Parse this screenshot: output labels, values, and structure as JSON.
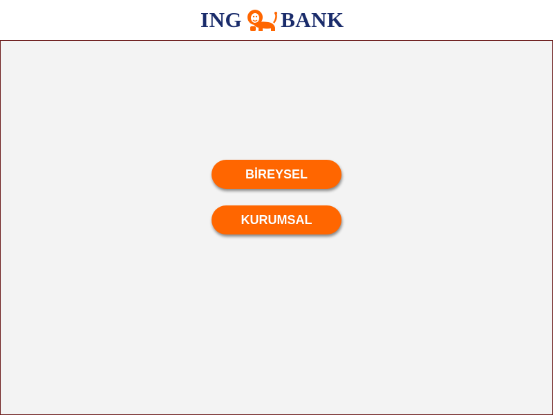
{
  "header": {
    "logo_text_left": "ING",
    "logo_text_right": "BANK",
    "logo_icon": "lion-icon"
  },
  "main": {
    "buttons": [
      {
        "label": "BİREYSEL"
      },
      {
        "label": "KURUMSAL"
      }
    ]
  },
  "colors": {
    "brand_navy": "#1a2c6b",
    "brand_orange": "#ff6600",
    "background": "#f3f3f3",
    "border": "#6b1a1a"
  }
}
